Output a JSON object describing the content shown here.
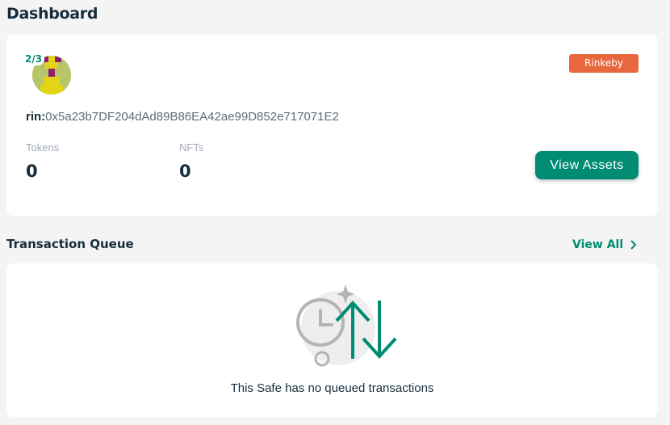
{
  "page": {
    "title": "Dashboard"
  },
  "safe": {
    "threshold": "2/3",
    "network": "Rinkeby",
    "address_prefix": "rin:",
    "address": "0x5a23b7DF204dAd89B86EA42ae99D852e717071E2",
    "stats": [
      {
        "label": "Tokens",
        "value": "0"
      },
      {
        "label": "NFTs",
        "value": "0"
      }
    ],
    "view_assets_label": "View Assets"
  },
  "queue": {
    "title": "Transaction Queue",
    "view_all_label": "View All",
    "empty_message": "This Safe has no queued transactions"
  },
  "colors": {
    "accent": "#008c73",
    "network": "#e8673c",
    "text": "#162d3d"
  },
  "icons": [
    "safe-identicon",
    "clock-icon",
    "transfer-arrows-icon",
    "chevron-right-icon"
  ]
}
